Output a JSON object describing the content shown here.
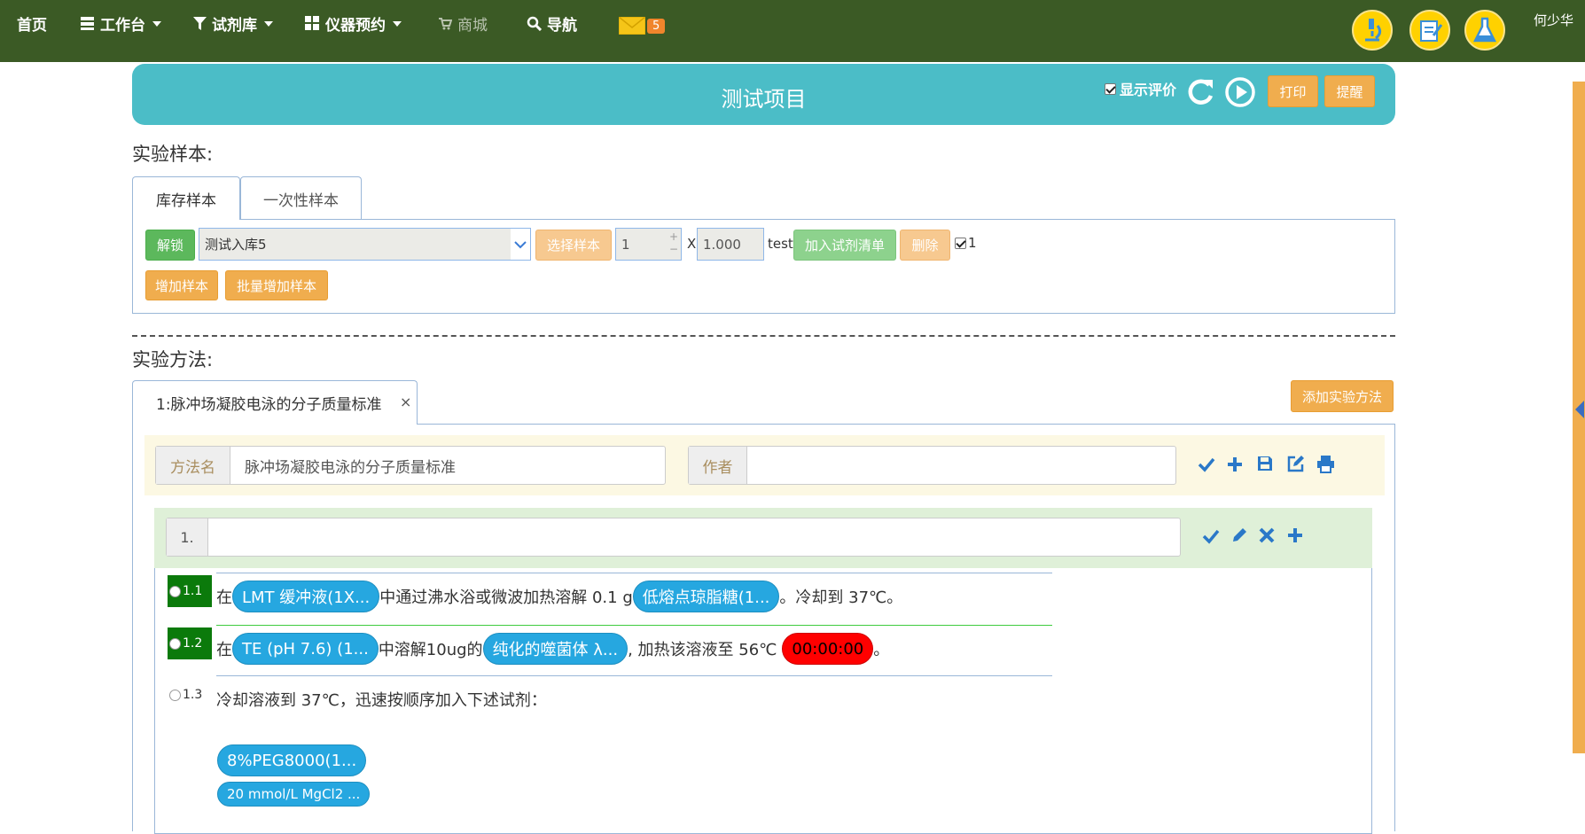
{
  "nav": {
    "home": "首页",
    "workbench": "工作台",
    "reagents": "试剂库",
    "instruments": "仪器预约",
    "mall": "商城",
    "navigation": "导航",
    "mail_count": "5",
    "username": "何少华"
  },
  "header": {
    "title": "测试项目",
    "show_eval_label": "显示评价",
    "print_label": "打印",
    "remind_label": "提醒"
  },
  "samples": {
    "section_label": "实验样本:",
    "tabs": [
      "库存样本",
      "一次性样本"
    ],
    "unlock_label": "解锁",
    "select_value": "测试入库5",
    "choose_sample_label": "选择样本",
    "quantity": "1",
    "times": "X",
    "amount": "1.000",
    "unit": "test",
    "add_to_list_label": "加入试剂清单",
    "delete_label": "删除",
    "checkbox_label": "1",
    "add_sample_label": "增加样本",
    "batch_add_label": "批量增加样本"
  },
  "methods": {
    "section_label": "实验方法:",
    "tab_label": "1:脉冲场凝胶电泳的分子质量标准",
    "tab_close": "×",
    "add_method_label": "添加实验方法",
    "method_name_label": "方法名",
    "method_name_value": "脉冲场凝胶电泳的分子质量标准",
    "author_label": "作者",
    "author_value": "",
    "step_number": "1.",
    "step_value": ""
  },
  "substeps": [
    {
      "num": "1.1",
      "parts": [
        "在",
        "LMT 缓冲液(1X...",
        "中通过沸水浴或微波加热溶解 0.1 g",
        "低熔点琼脂糖(1...",
        "。冷却到 37℃。"
      ]
    },
    {
      "num": "1.2",
      "parts": [
        "在",
        "TE (pH 7.6) (1...",
        "中溶解10ug的",
        "纯化的噬菌体 λ...",
        ", 加热该溶液至 56℃",
        "00:00:00",
        "。"
      ]
    },
    {
      "num": "1.3",
      "text": "冷却溶液到 37℃，迅速按顺序加入下述试剂："
    }
  ],
  "reagent_pills": [
    "8%PEG8000(1...",
    "20 mmol/L MgCl2 ..."
  ],
  "colors": {
    "nav_bg": "#3b5a25",
    "header_bg": "#4bbdc7",
    "orange": "#f0ad4e",
    "green": "#5cb85c",
    "pill_blue": "#26a7e0",
    "timer_red": "#ff0000"
  },
  "icons": [
    "list-icon",
    "filter-icon",
    "grid-icon",
    "cart-icon",
    "search-icon",
    "mail-icon",
    "microscope-icon",
    "notepad-icon",
    "flask-icon",
    "refresh-icon",
    "play-icon",
    "check-icon",
    "plus-icon",
    "save-icon",
    "edit-icon",
    "print-icon",
    "pencil-icon",
    "close-icon"
  ]
}
